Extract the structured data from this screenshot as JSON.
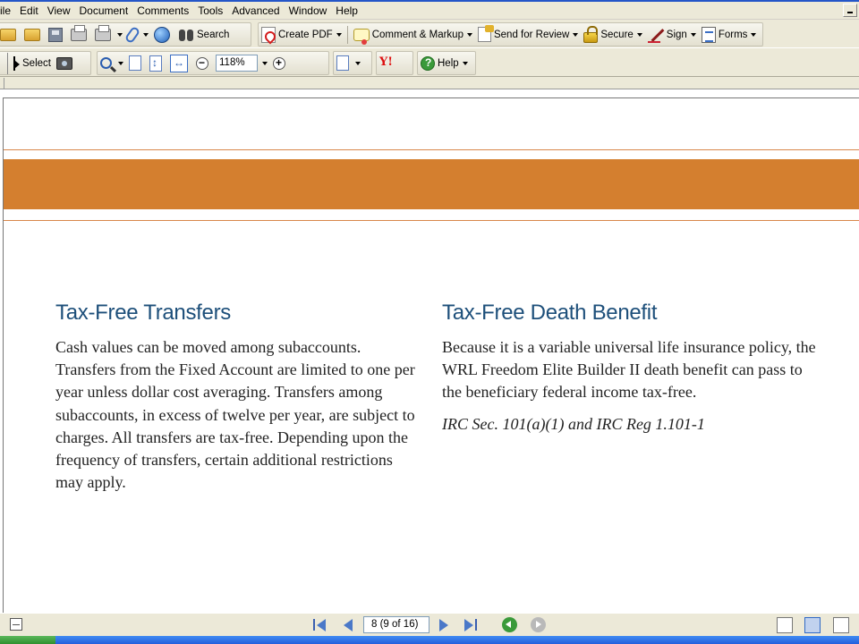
{
  "menu": [
    "ile",
    "Edit",
    "View",
    "Document",
    "Comments",
    "Tools",
    "Advanced",
    "Window",
    "Help"
  ],
  "toolbar1": {
    "search": "Search",
    "create_pdf": "Create PDF",
    "comment_markup": "Comment & Markup",
    "send_review": "Send for Review",
    "secure": "Secure",
    "sign": "Sign",
    "forms": "Forms"
  },
  "toolbar2": {
    "select": "Select",
    "zoom": "118%",
    "help": "Help",
    "yahoo": "Y!"
  },
  "document": {
    "left_heading": "Tax-Free Transfers",
    "left_body": "Cash values can be moved among subaccounts. Transfers from the Fixed Account are limited to one per year unless dollar cost averaging. Transfers among subaccounts, in excess of twelve per year, are subject to charges. All transfers are tax-free. Depending upon the frequency of transfers, certain additional restrictions may apply.",
    "right_heading": "Tax-Free Death Benefit",
    "right_body": "Because it is a variable universal life insurance policy, the WRL Freedom Elite Builder II death benefit can pass to the beneficiary federal income tax-free.",
    "right_cite": "IRC Sec. 101(a)(1) and IRC Reg 1.101-1",
    "band_color": "#d47f2f",
    "heading_color": "#1d4f7a"
  },
  "status": {
    "page_indicator": "8  (9 of 16)"
  }
}
